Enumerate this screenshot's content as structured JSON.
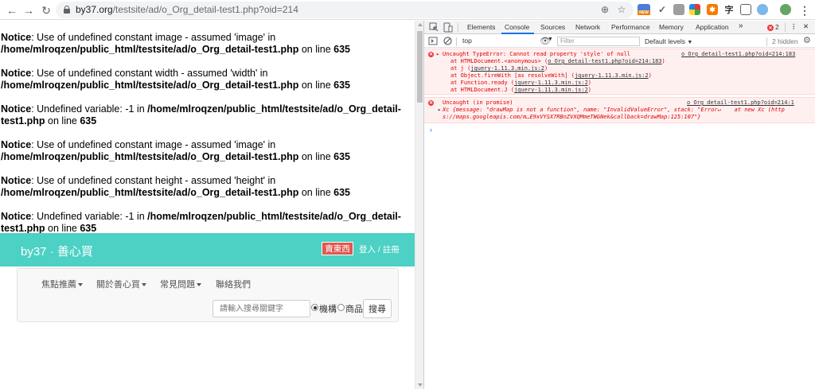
{
  "browser": {
    "url_host": "by37.org",
    "url_path": "/testsite/ad/o_Org_detail-test1.php?oid=214",
    "ext_badge": "NEW",
    "ext_char_1": "字"
  },
  "page": {
    "notices": [
      {
        "label": "Notice",
        "text": ": Use of undefined constant image - assumed 'image' in ",
        "path": "/home/mlroqzen/public_html/testsite/ad/o_Org_detail-test1.php",
        "online": " on line ",
        "line": "635"
      },
      {
        "label": "Notice",
        "text": ": Use of undefined constant width - assumed 'width' in ",
        "path": "/home/mlroqzen/public_html/testsite/ad/o_Org_detail-test1.php",
        "online": " on line ",
        "line": "635"
      },
      {
        "label": "Notice",
        "text": ": Undefined variable: -1 in ",
        "path": "/home/mlroqzen/public_html/testsite/ad/o_Org_detail-test1.php",
        "online": " on line ",
        "line": "635"
      },
      {
        "label": "Notice",
        "text": ": Use of undefined constant image - assumed 'image' in ",
        "path": "/home/mlroqzen/public_html/testsite/ad/o_Org_detail-test1.php",
        "online": " on line ",
        "line": "635"
      },
      {
        "label": "Notice",
        "text": ": Use of undefined constant height - assumed 'height' in ",
        "path": "/home/mlroqzen/public_html/testsite/ad/o_Org_detail-test1.php",
        "online": " on line ",
        "line": "635"
      },
      {
        "label": "Notice",
        "text": ": Undefined variable: -1 in ",
        "path": "/home/mlroqzen/public_html/testsite/ad/o_Org_detail-test1.php",
        "online": " on line ",
        "line": "635"
      }
    ],
    "navbar": {
      "brand": "by37 · 善心買",
      "sell_button": "賣東西",
      "login_link": "登入 / 註冊",
      "color": "#4cd1c4"
    },
    "menu": {
      "items": [
        "焦點推薦",
        "關於善心買",
        "常見問題",
        "聯絡我們"
      ],
      "search_placeholder": "請輸入搜尋關鍵字",
      "radio_options": [
        "機構",
        "商品"
      ],
      "radio_selected": "機構",
      "search_button": "搜尋"
    }
  },
  "devtools": {
    "tabs": [
      "Elements",
      "Console",
      "Sources",
      "Network",
      "Performance",
      "Memory",
      "Application"
    ],
    "active_tab": "Console",
    "error_count": "2",
    "context": "top",
    "filter_placeholder": "Filter",
    "levels": "Default levels",
    "hidden": "2 hidden",
    "errors": [
      {
        "message": "Uncaught TypeError: Cannot read property 'style' of null",
        "source": "o_Org_detail-test1.php?oid=214:183",
        "stack": [
          {
            "prefix": "at HTMLDocument.<anonymous> (",
            "link": "o_Org_detail-test1.php?oid=214:183",
            "suffix": ")"
          },
          {
            "prefix": "at j (",
            "link": "jquery-1.11.3.min.js:2",
            "suffix": ")"
          },
          {
            "prefix": "at Object.fireWith [as resolveWith] (",
            "link": "jquery-1.11.3.min.js:2",
            "suffix": ")"
          },
          {
            "prefix": "at Function.ready (",
            "link": "jquery-1.11.3.min.js:2",
            "suffix": ")"
          },
          {
            "prefix": "at HTMLDocument.J (",
            "link": "jquery-1.11.3.min.js:2",
            "suffix": ")"
          }
        ]
      },
      {
        "message": "Uncaught (in promise)",
        "source": "o_Org_detail-test1.php?oid=214:1",
        "detail_1": "Xc {message: \"drawMap is not a function\", name: \"InvalidValueError\", stack: \"Error↵    at new Xc (http",
        "detail_2": "s://maps.googleapis.com/m…E9xVYSX7RBnZVXQMmeTWGNek&callback=drawMap:125:107\"}"
      }
    ]
  }
}
